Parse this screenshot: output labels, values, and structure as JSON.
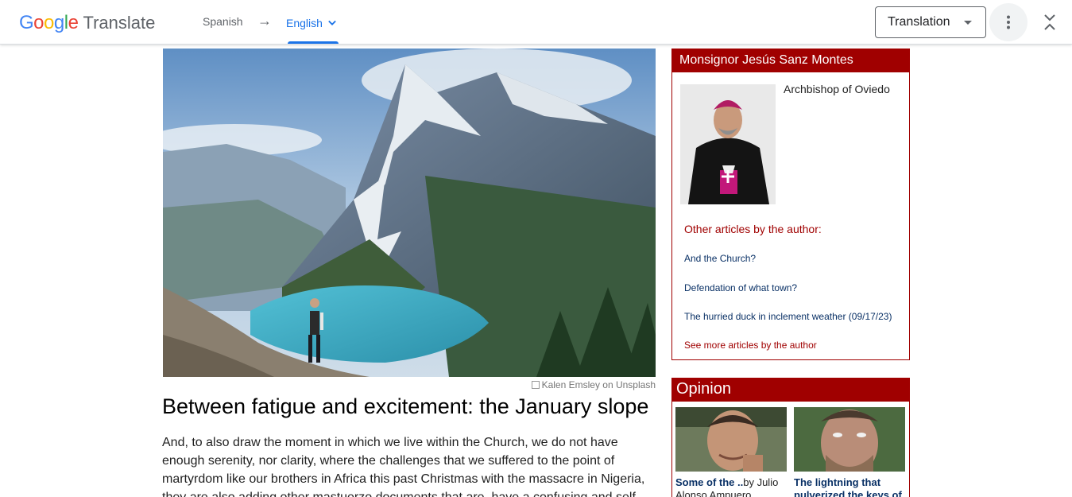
{
  "translate_bar": {
    "logo_google": "Google",
    "logo_translate": "Translate",
    "source_language": "Spanish",
    "arrow": "→",
    "target_language": "English",
    "view_mode": "Translation",
    "colors": {
      "accent": "#1a73e8",
      "google_blue": "#4285f4",
      "google_red": "#ea4335",
      "google_yellow": "#fbbc05",
      "google_green": "#34a853"
    }
  },
  "article": {
    "photo_credit": "Kalen Emsley on Unsplash",
    "headline": "Between fatigue and excitement: the January slope",
    "body": "And, to also draw the moment in which we live within the Church, we do not have enough serenity, nor clarity, where the challenges that we suffered to the point of martyrdom like our brothers in Africa this past Christmas with the massacre in Nigeria, they are also adding other mastuerzo documents that are, have a confusing and self"
  },
  "author_box": {
    "name": "Monsignor Jesús Sanz Montes",
    "role": "Archbishop of Oviedo",
    "other_title": "Other articles by the author:",
    "links": [
      "And the Church?",
      "Defendation of what town?",
      "The hurried duck in inclement weather (09/17/23)"
    ],
    "see_more": "See more articles by the author",
    "brand_color": "#a00000"
  },
  "opinion": {
    "title": "Opinion",
    "cards": [
      {
        "title": "Some of the ..",
        "byline": "by Julio Alonso Ampuero"
      },
      {
        "title": "The lightning that pulverized the keys of",
        "byline": ""
      }
    ]
  }
}
